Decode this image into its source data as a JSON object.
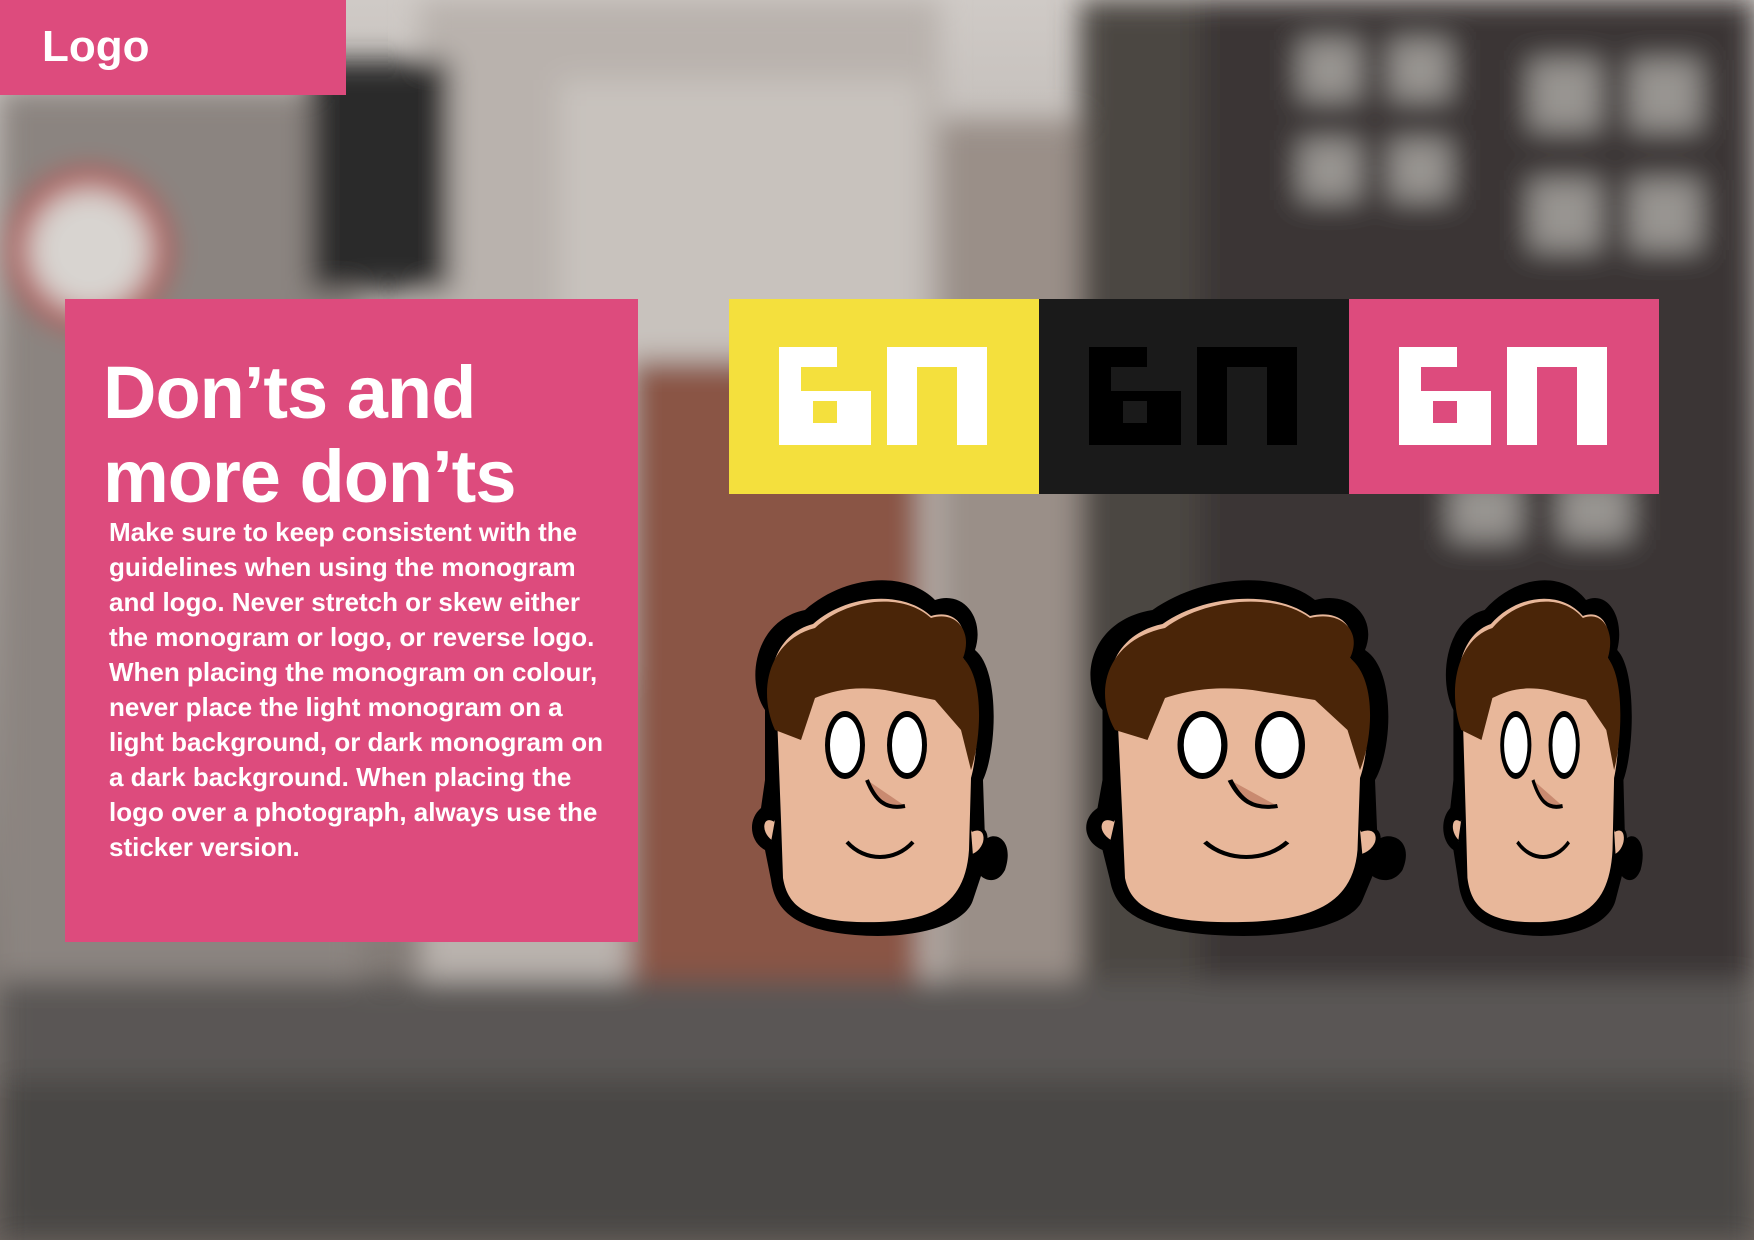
{
  "header": {
    "tab_label": "Logo"
  },
  "panel": {
    "title": "Don’ts and more don’ts",
    "body": "Make sure to keep consistent with the guidelines when using the monogram and logo. Never stretch or skew either the monogram or logo, or reverse logo. When placing the monogram on colour, never place the light monogram on a light background, or dark monogram on a dark background. When placing the logo over a photograph, always use the sticker version."
  },
  "monograms": [
    {
      "name": "yellow",
      "background": "#f4e03d",
      "mark": "#ffffff",
      "dot": "#f4e03d"
    },
    {
      "name": "black",
      "background": "#1a1a1a",
      "mark": "#000000",
      "dot": "#1a1a1a"
    },
    {
      "name": "pink",
      "background": "#dd4b7d",
      "mark": "#ffffff",
      "dot": "#dd4b7d"
    }
  ],
  "colors": {
    "accent": "#dd4b7d",
    "hair": "#4a2508",
    "skin": "#e8b79a"
  },
  "icons": [
    "photo-background",
    "monogram-mark",
    "character-head"
  ]
}
